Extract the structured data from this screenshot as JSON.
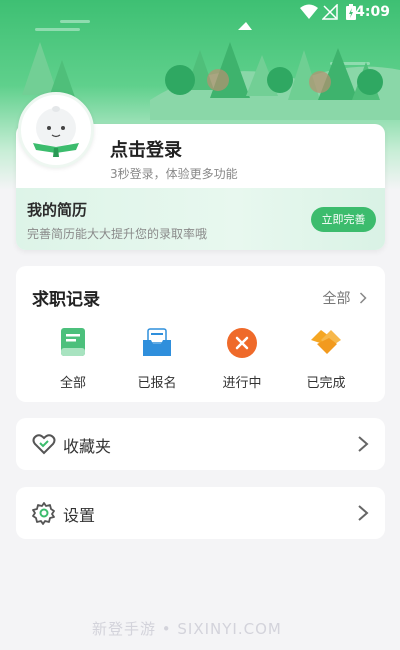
{
  "status_bar": {
    "time": "4:09"
  },
  "profile": {
    "login_title": "点击登录",
    "login_subtitle": "3秒登录，体验更多功能",
    "resume_title": "我的简历",
    "resume_subtitle": "完善简历能大大提升您的录取率哦",
    "complete_button": "立即完善"
  },
  "jobs": {
    "title": "职记录",
    "title_prefix": "求",
    "all_label": "全部",
    "items": [
      {
        "label": "全部",
        "icon": "document-icon"
      },
      {
        "label": "已报名",
        "icon": "inbox-icon"
      },
      {
        "label": "进行中",
        "icon": "in-progress-icon"
      },
      {
        "label": "已完成",
        "icon": "handshake-icon"
      }
    ]
  },
  "menu": {
    "favorites": "收藏夹",
    "settings": "设置"
  },
  "watermark": "新登手游 • SIXINYI.COM",
  "colors": {
    "brand_green": "#3cbc6d",
    "orange": "#ef6a2a"
  }
}
